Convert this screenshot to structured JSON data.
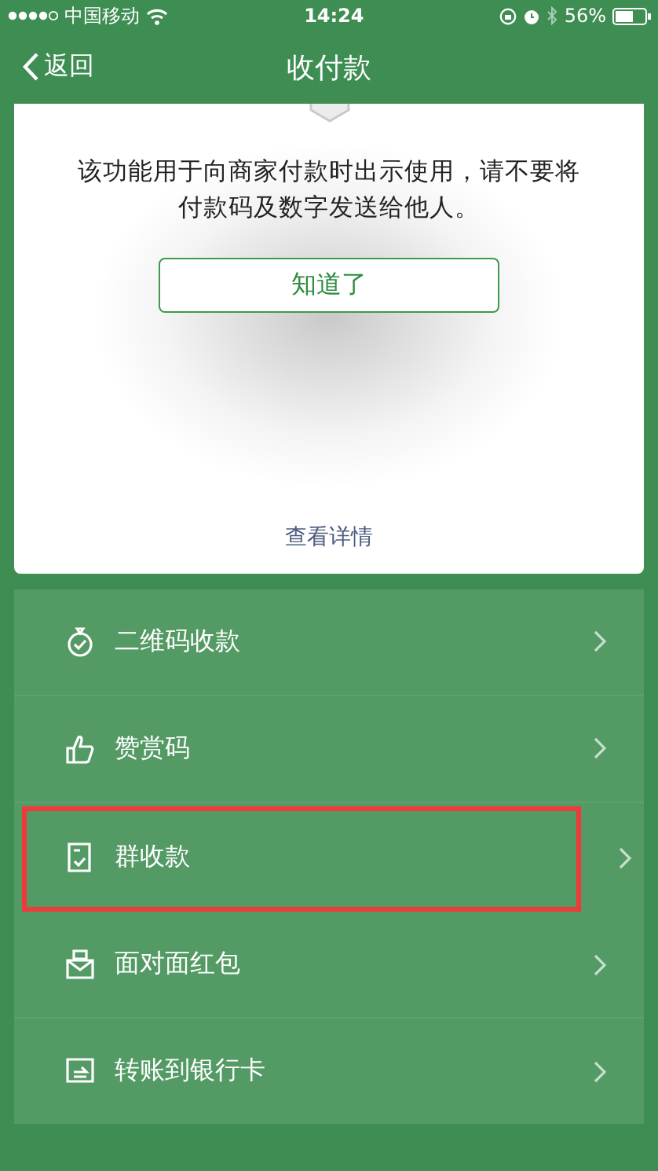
{
  "status_bar": {
    "carrier": "中国移动",
    "time": "14:24",
    "battery": "56%"
  },
  "nav": {
    "back": "返回",
    "title": "收付款"
  },
  "notice": {
    "message": "该功能用于向商家付款时出示使用，请不要将付款码及数字发送给他人。",
    "button": "知道了",
    "link": "查看详情"
  },
  "menu": [
    {
      "kind": "qr",
      "label": "二维码收款",
      "highlighted": false
    },
    {
      "kind": "thumb",
      "label": "赞赏码",
      "highlighted": false
    },
    {
      "kind": "group",
      "label": "群收款",
      "highlighted": true
    },
    {
      "kind": "packet",
      "label": "面对面红包",
      "highlighted": false
    },
    {
      "kind": "bank",
      "label": "转账到银行卡",
      "highlighted": false
    }
  ]
}
